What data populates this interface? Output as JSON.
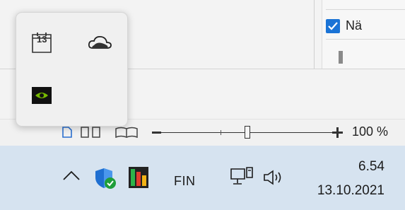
{
  "background_doc": {
    "checkbox_label": "Nä"
  },
  "statusbar": {
    "zoom_level": "100 %",
    "zoom_percent": 100
  },
  "flyout": {
    "items": [
      {
        "icon": "calendar-icon",
        "text": "13"
      },
      {
        "icon": "onedrive-cloud-icon"
      },
      {
        "icon": "nvidia-icon"
      }
    ]
  },
  "taskbar": {
    "show_hidden_icons": "chevron-up-icon",
    "tray_icons": [
      "windows-security-icon",
      "app-bars-icon"
    ],
    "language": "FIN",
    "network_icon": "network-icon",
    "volume_icon": "speaker-icon",
    "time": "6.54",
    "date": "13.10.2021"
  },
  "colors": {
    "taskbar_bg": "#d6e3f0",
    "accent_checkbox": "#1a73d6",
    "nvidia_green": "#76b900",
    "shield_blue": "#1f6fd1",
    "check_green": "#1f9e3a"
  }
}
